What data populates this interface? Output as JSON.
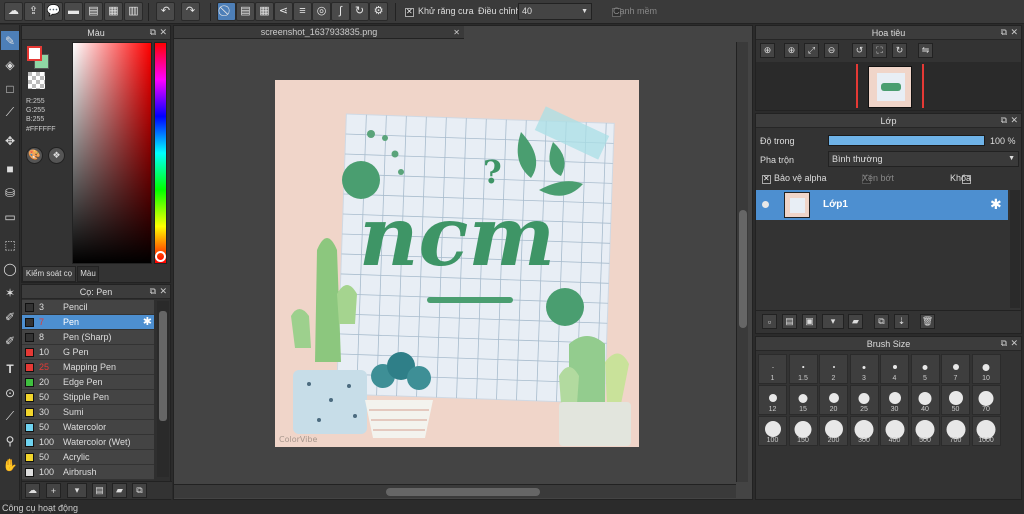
{
  "toolbar": {
    "anti_alias_label": "Khử răng cưa",
    "adjust_label": "Điều chỉnh",
    "adjust_value": "40",
    "soft_edge_label": "Cạnh mềm"
  },
  "color_panel": {
    "title": "Màu",
    "r_label": "R:255",
    "g_label": "G:255",
    "b_label": "B:255",
    "hex": "#FFFFFF",
    "tab_control": "Kiểm soát cọ",
    "tab_color": "Màu"
  },
  "brush_panel": {
    "title": "Cọ: Pen",
    "brushes": [
      {
        "size": "3",
        "name": "Pencil",
        "color": "#333333"
      },
      {
        "size": "7",
        "name": "Pen",
        "color": "#333333"
      },
      {
        "size": "8",
        "name": "Pen (Sharp)",
        "color": "#333333"
      },
      {
        "size": "10",
        "name": "G Pen",
        "color": "#e53935"
      },
      {
        "size": "25",
        "name": "Mapping Pen",
        "color": "#e53935"
      },
      {
        "size": "20",
        "name": "Edge Pen",
        "color": "#3fbf3f"
      },
      {
        "size": "50",
        "name": "Stipple Pen",
        "color": "#f2d52c"
      },
      {
        "size": "30",
        "name": "Sumi",
        "color": "#f2d52c"
      },
      {
        "size": "50",
        "name": "Watercolor",
        "color": "#6fd3f0"
      },
      {
        "size": "100",
        "name": "Watercolor (Wet)",
        "color": "#6fd3f0"
      },
      {
        "size": "50",
        "name": "Acrylic",
        "color": "#f2d52c"
      },
      {
        "size": "100",
        "name": "Airbrush",
        "color": "#dddddd"
      }
    ]
  },
  "canvas": {
    "tab_title": "screenshot_1637933835.png"
  },
  "navigator": {
    "title": "Hoa tiêu"
  },
  "layer_panel": {
    "title": "Lớp",
    "opacity_label": "Độ trong",
    "opacity_value": "100 %",
    "opacity_fraction": 1.0,
    "blend_label": "Pha trộn",
    "blend_value": "Bình thường",
    "protect_alpha": "Bảo vệ alpha",
    "clipping": "Xén bớt",
    "lock": "Khóa",
    "layers": [
      {
        "name": "Lớp1"
      }
    ]
  },
  "brush_size": {
    "title": "Brush Size",
    "sizes": [
      "1",
      "1.5",
      "2",
      "3",
      "4",
      "5",
      "7",
      "10",
      "12",
      "15",
      "20",
      "25",
      "30",
      "40",
      "50",
      "70",
      "100",
      "150",
      "200",
      "300",
      "400",
      "500",
      "700",
      "1000"
    ]
  },
  "status": {
    "text": "Công cụ hoạt động"
  },
  "artwork": {
    "title_text": "ncm",
    "question": "?",
    "watermark": "ColorVibe"
  }
}
